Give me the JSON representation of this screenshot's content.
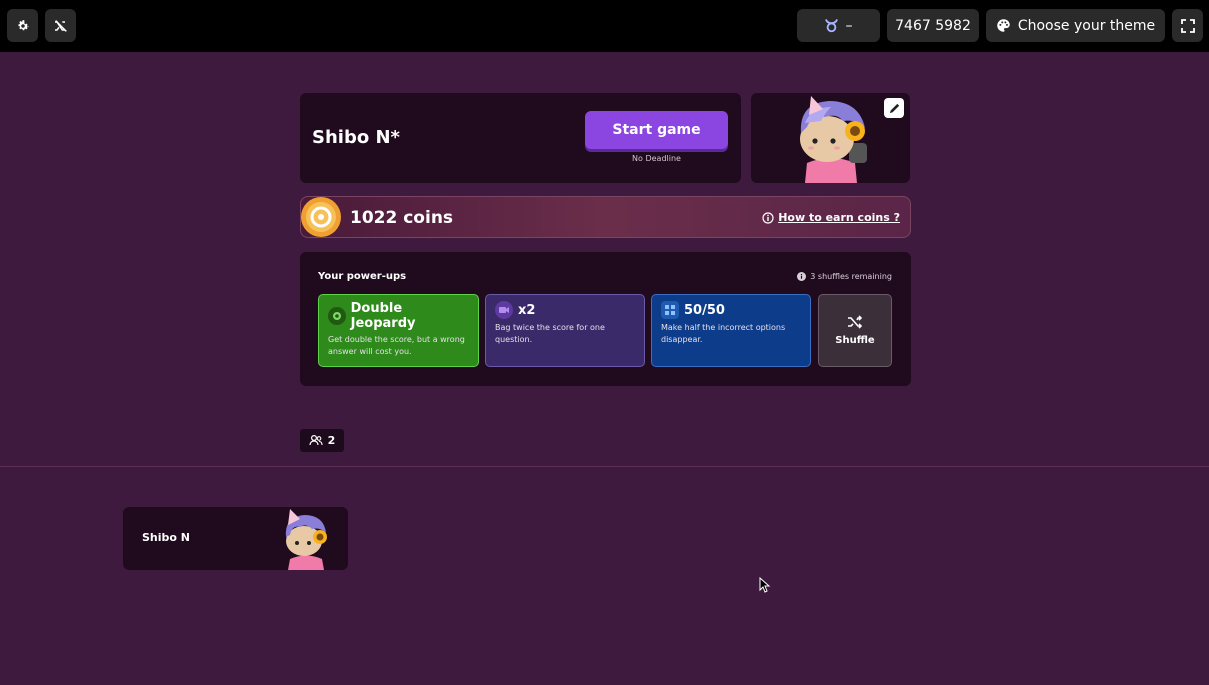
{
  "topbar": {
    "player_count_label": "–",
    "game_code": "7467 5982",
    "theme_label": "Choose your theme"
  },
  "player": {
    "name": "Shibo N*",
    "start_label": "Start game",
    "deadline": "No Deadline"
  },
  "coins": {
    "label": "1022 coins",
    "earn_link": "How to earn coins ?"
  },
  "powerups": {
    "title": "Your power-ups",
    "shuffles_remaining": "3 shuffles remaining",
    "items": [
      {
        "name": "Double Jeopardy",
        "desc": "Get double the score, but a wrong answer will cost you.",
        "icon": "jeopardy-icon"
      },
      {
        "name": "x2",
        "desc": "Bag twice the score for one question.",
        "icon": "x2-icon"
      },
      {
        "name": "50/50",
        "desc": "Make half the incorrect options disappear.",
        "icon": "fifty-fifty-icon"
      }
    ],
    "shuffle_label": "Shuffle"
  },
  "lobby": {
    "count": "2",
    "players": [
      {
        "name": "Shibo N"
      }
    ]
  },
  "colors": {
    "background": "#3f1a3f",
    "start_button": "#8b45e0",
    "double_jeopardy": "#2f8a1c",
    "x2": "#3b2a6a",
    "fifty_fifty": "#0d3d8a"
  }
}
